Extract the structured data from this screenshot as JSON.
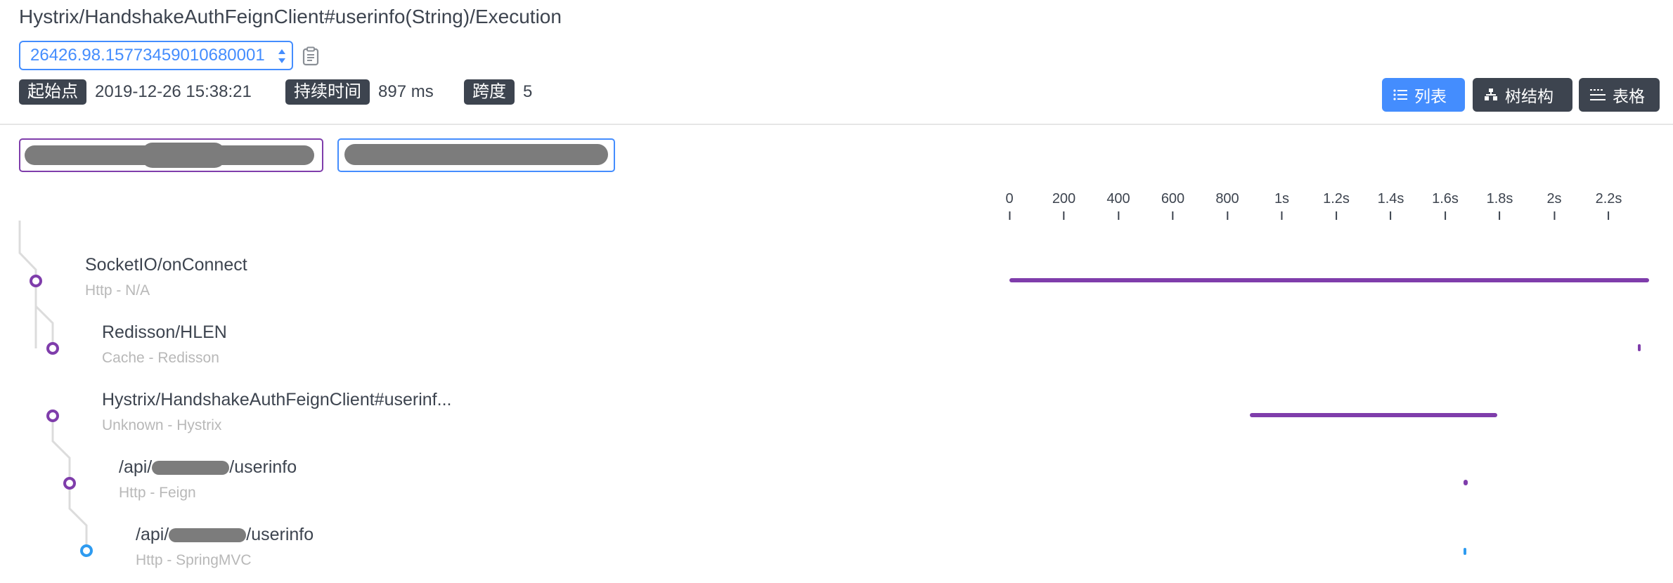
{
  "header": {
    "title": "Hystrix/HandshakeAuthFeignClient#userinfo(String)/Execution",
    "trace_id": "26426.98.15773459010680001",
    "start_label": "起始点",
    "start_value": "2019-12-26 15:38:21",
    "duration_label": "持续时间",
    "duration_value": "897 ms",
    "spans_label": "跨度",
    "spans_value": "5"
  },
  "view_buttons": {
    "list": "列表",
    "tree": "树结构",
    "table": "表格",
    "active": "list"
  },
  "colors": {
    "accent": "#448dfe",
    "dark": "#3d444f",
    "purple": "#7f3dab"
  },
  "axis_ticks": [
    "0",
    "200",
    "400",
    "600",
    "800",
    "1s",
    "1.2s",
    "1.4s",
    "1.6s",
    "1.8s",
    "2s",
    "2.2s"
  ],
  "spans": [
    {
      "name": "SocketIO/onConnect",
      "name_after": "",
      "sub": "Http - N/A",
      "redacted": false
    },
    {
      "name": "Redisson/HLEN",
      "name_after": "",
      "sub": "Cache - Redisson",
      "redacted": false
    },
    {
      "name": "Hystrix/HandshakeAuthFeignClient#userinf...",
      "name_after": "",
      "sub": "Unknown - Hystrix",
      "redacted": false
    },
    {
      "name": "/api/",
      "name_after": "/userinfo",
      "sub": "Http - Feign",
      "redacted": true
    },
    {
      "name": "/api/",
      "name_after": "/userinfo",
      "sub": "Http - SpringMVC",
      "redacted": true
    }
  ]
}
